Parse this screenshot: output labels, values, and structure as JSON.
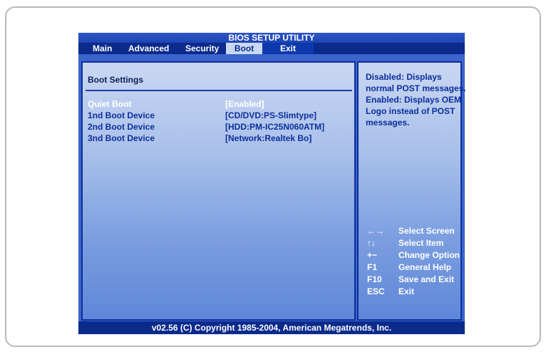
{
  "title": "BIOS SETUP UTILITY",
  "tabs": [
    {
      "label": "Main"
    },
    {
      "label": "Advanced"
    },
    {
      "label": "Security"
    },
    {
      "label": "Boot",
      "active": true
    },
    {
      "label": "Exit"
    }
  ],
  "boot": {
    "heading": "Boot Settings",
    "rows": [
      {
        "label": "Quiet Boot",
        "value": "[Enabled]",
        "selected": true
      },
      {
        "label": "1nd Boot Device",
        "value": "[CD/DVD:PS-Slimtype]"
      },
      {
        "label": "2nd Boot Device",
        "value": "[HDD:PM-IC25N060ATM]"
      },
      {
        "label": "3nd Boot Device",
        "value": "[Network:Realtek Bo]"
      }
    ]
  },
  "help": {
    "lines": [
      "Disabled: Displays",
      "normal POST messages.",
      "Enabled: Displays OEM",
      "Logo instead of POST",
      "messages."
    ]
  },
  "keys": [
    {
      "key": "←→",
      "desc": "Select Screen"
    },
    {
      "key": "↑↓",
      "desc": "Select Item"
    },
    {
      "key": "+−",
      "desc": "Change Option"
    },
    {
      "key": "F1",
      "desc": "General Help"
    },
    {
      "key": "F10",
      "desc": "Save and Exit"
    },
    {
      "key": "ESC",
      "desc": "Exit"
    }
  ],
  "footer": "v02.56 (C) Copyright  1985-2004, American Megatrends, Inc."
}
